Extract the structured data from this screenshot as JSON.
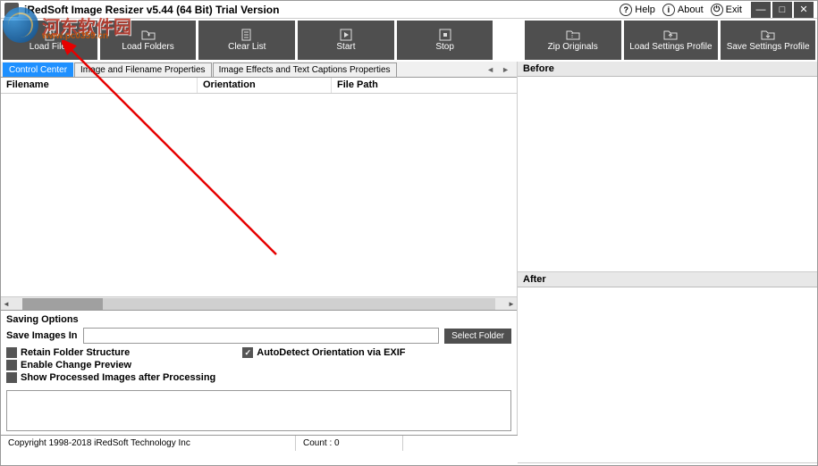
{
  "title": "iRedSoft Image Resizer v5.44 (64 Bit) Trial Version",
  "header": {
    "help": "Help",
    "about": "About",
    "exit": "Exit"
  },
  "toolbar": {
    "loadFiles": "Load Files",
    "loadFolders": "Load Folders",
    "clearList": "Clear List",
    "start": "Start",
    "stop": "Stop",
    "zipOriginals": "Zip Originals",
    "loadProfile": "Load Settings Profile",
    "saveProfile": "Save Settings Profile"
  },
  "tabs": {
    "control": "Control Center",
    "imageProps": "Image and Filename Properties",
    "effects": "Image Effects and Text Captions Properties"
  },
  "fileHeaders": {
    "filename": "Filename",
    "orientation": "Orientation",
    "filepath": "File Path"
  },
  "saving": {
    "legend": "Saving Options",
    "saveIn": "Save Images In",
    "saveInValue": "",
    "selectFolder": "Select Folder",
    "retainStructure": "Retain Folder Structure",
    "enablePreview": "Enable Change Preview",
    "showProcessed": "Show Processed Images after Processing",
    "autoDetect": "AutoDetect Orientation via EXIF",
    "retainStructureChecked": false,
    "enablePreviewChecked": false,
    "showProcessedChecked": false,
    "autoDetectChecked": true
  },
  "preview": {
    "before": "Before",
    "after": "After"
  },
  "status": {
    "copyright": "Copyright 1998-2018 iRedSoft Technology Inc",
    "count": "Count : 0"
  },
  "watermark": {
    "cn": "河东软件园",
    "url": "www.pc0359.cn"
  }
}
